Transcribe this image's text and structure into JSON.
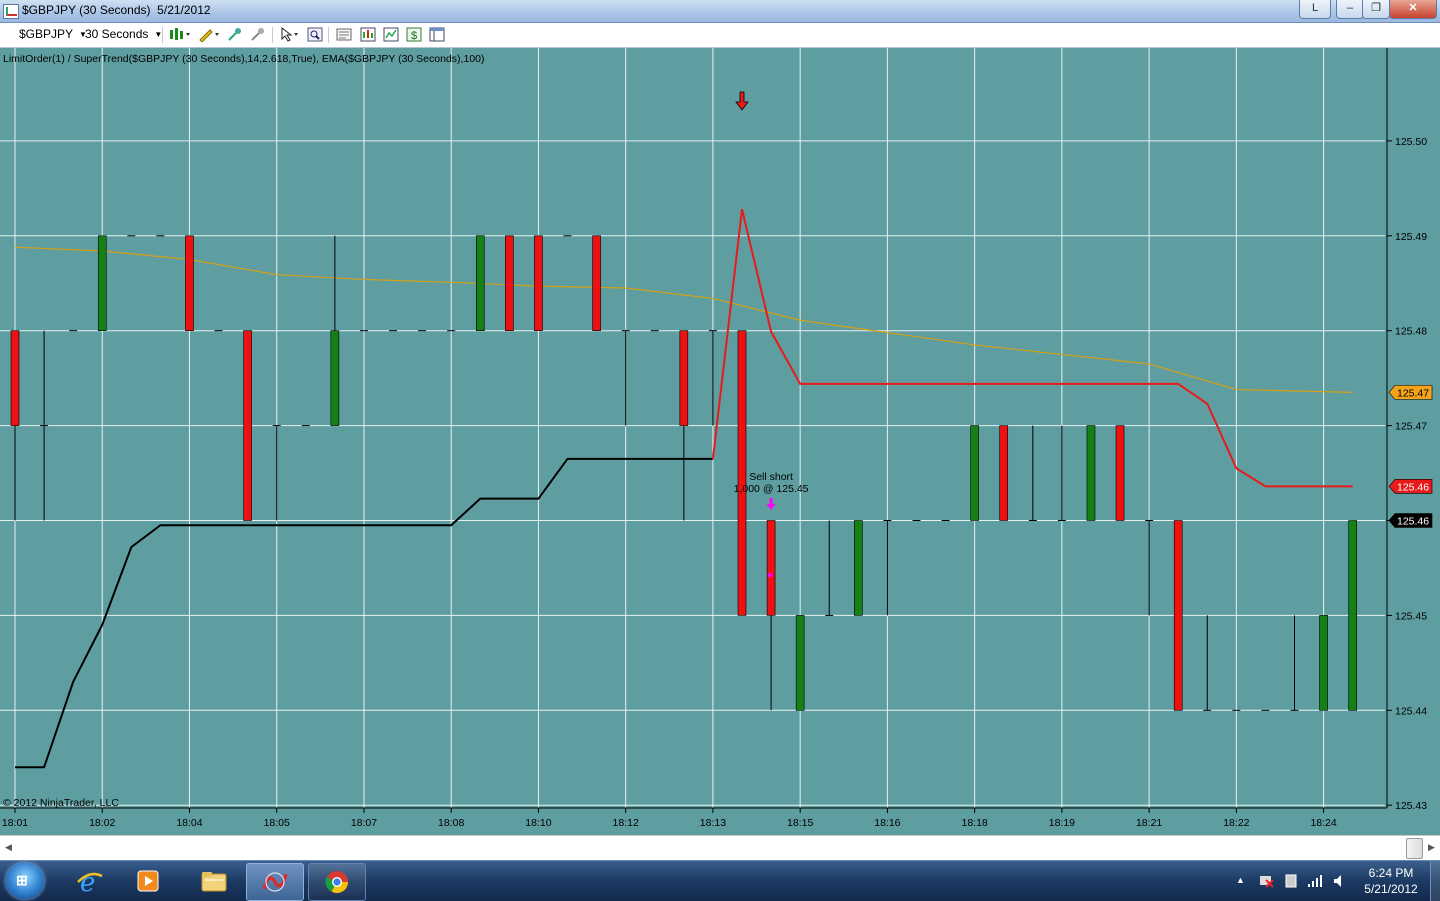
{
  "window": {
    "title": "$GBPJPY (30 Seconds)  5/21/2012",
    "btn_l": "L",
    "btn_min": "–",
    "btn_max": "❐",
    "btn_close": "✕"
  },
  "toolbar": {
    "instrument": "$GBPJPY",
    "period": "30 Seconds"
  },
  "chart_data": {
    "type": "candlestick",
    "title": "LimitOrder(1) / SuperTrend($GBPJPY (30 Seconds),14,2.618,True), EMA($GBPJPY (30 Seconds),100)",
    "copyright": "© 2012 NinjaTrader, LLC",
    "ylim": [
      125.43,
      125.51
    ],
    "y_ticks": [
      125.43,
      125.44,
      125.45,
      125.46,
      125.47,
      125.48,
      125.49,
      125.5
    ],
    "y_tick_labels": [
      "125.43",
      "125.44",
      "125.45",
      "125.46",
      "125.47",
      "125.48",
      "125.49",
      "125.50"
    ],
    "x_tick_labels": [
      "18:01",
      "18:02",
      "18:04",
      "18:05",
      "18:07",
      "18:08",
      "18:10",
      "18:12",
      "18:13",
      "18:15",
      "18:16",
      "18:18",
      "18:19",
      "18:21",
      "18:22",
      "18:24"
    ],
    "x_tick_bars": [
      0,
      3,
      6,
      9,
      12,
      15,
      18,
      21,
      24,
      27,
      30,
      33,
      36,
      39,
      42,
      45
    ],
    "grid": true,
    "bars": [
      {
        "o": 125.48,
        "h": 125.48,
        "l": 125.46,
        "c": 125.47
      },
      {
        "o": 125.47,
        "h": 125.48,
        "l": 125.46,
        "c": 125.47
      },
      {
        "o": 125.48,
        "h": 125.48,
        "l": 125.48,
        "c": 125.48
      },
      {
        "o": 125.48,
        "h": 125.49,
        "l": 125.48,
        "c": 125.49
      },
      {
        "o": 125.49,
        "h": 125.49,
        "l": 125.49,
        "c": 125.49
      },
      {
        "o": 125.49,
        "h": 125.49,
        "l": 125.49,
        "c": 125.49
      },
      {
        "o": 125.49,
        "h": 125.49,
        "l": 125.48,
        "c": 125.48
      },
      {
        "o": 125.48,
        "h": 125.48,
        "l": 125.48,
        "c": 125.48
      },
      {
        "o": 125.48,
        "h": 125.48,
        "l": 125.46,
        "c": 125.46
      },
      {
        "o": 125.47,
        "h": 125.47,
        "l": 125.46,
        "c": 125.47
      },
      {
        "o": 125.47,
        "h": 125.47,
        "l": 125.47,
        "c": 125.47
      },
      {
        "o": 125.47,
        "h": 125.49,
        "l": 125.47,
        "c": 125.48
      },
      {
        "o": 125.48,
        "h": 125.48,
        "l": 125.48,
        "c": 125.48
      },
      {
        "o": 125.48,
        "h": 125.48,
        "l": 125.48,
        "c": 125.48
      },
      {
        "o": 125.48,
        "h": 125.48,
        "l": 125.48,
        "c": 125.48
      },
      {
        "o": 125.48,
        "h": 125.48,
        "l": 125.48,
        "c": 125.48
      },
      {
        "o": 125.48,
        "h": 125.49,
        "l": 125.48,
        "c": 125.49
      },
      {
        "o": 125.49,
        "h": 125.49,
        "l": 125.48,
        "c": 125.48
      },
      {
        "o": 125.49,
        "h": 125.49,
        "l": 125.48,
        "c": 125.48
      },
      {
        "o": 125.49,
        "h": 125.49,
        "l": 125.49,
        "c": 125.49
      },
      {
        "o": 125.49,
        "h": 125.49,
        "l": 125.48,
        "c": 125.48
      },
      {
        "o": 125.48,
        "h": 125.48,
        "l": 125.47,
        "c": 125.48
      },
      {
        "o": 125.48,
        "h": 125.48,
        "l": 125.48,
        "c": 125.48
      },
      {
        "o": 125.48,
        "h": 125.48,
        "l": 125.46,
        "c": 125.47
      },
      {
        "o": 125.48,
        "h": 125.48,
        "l": 125.47,
        "c": 125.48
      },
      {
        "o": 125.48,
        "h": 125.48,
        "l": 125.45,
        "c": 125.45
      },
      {
        "o": 125.46,
        "h": 125.46,
        "l": 125.44,
        "c": 125.45
      },
      {
        "o": 125.44,
        "h": 125.45,
        "l": 125.44,
        "c": 125.45
      },
      {
        "o": 125.45,
        "h": 125.46,
        "l": 125.45,
        "c": 125.45
      },
      {
        "o": 125.45,
        "h": 125.46,
        "l": 125.45,
        "c": 125.46
      },
      {
        "o": 125.46,
        "h": 125.46,
        "l": 125.45,
        "c": 125.46
      },
      {
        "o": 125.46,
        "h": 125.46,
        "l": 125.46,
        "c": 125.46
      },
      {
        "o": 125.46,
        "h": 125.46,
        "l": 125.46,
        "c": 125.46
      },
      {
        "o": 125.46,
        "h": 125.47,
        "l": 125.46,
        "c": 125.47
      },
      {
        "o": 125.47,
        "h": 125.47,
        "l": 125.46,
        "c": 125.46
      },
      {
        "o": 125.46,
        "h": 125.47,
        "l": 125.46,
        "c": 125.46
      },
      {
        "o": 125.46,
        "h": 125.47,
        "l": 125.46,
        "c": 125.46
      },
      {
        "o": 125.46,
        "h": 125.47,
        "l": 125.46,
        "c": 125.47
      },
      {
        "o": 125.47,
        "h": 125.47,
        "l": 125.46,
        "c": 125.46
      },
      {
        "o": 125.46,
        "h": 125.46,
        "l": 125.45,
        "c": 125.46
      },
      {
        "o": 125.46,
        "h": 125.46,
        "l": 125.44,
        "c": 125.44
      },
      {
        "o": 125.44,
        "h": 125.45,
        "l": 125.44,
        "c": 125.44
      },
      {
        "o": 125.44,
        "h": 125.44,
        "l": 125.44,
        "c": 125.44
      },
      {
        "o": 125.44,
        "h": 125.44,
        "l": 125.44,
        "c": 125.44
      },
      {
        "o": 125.44,
        "h": 125.45,
        "l": 125.44,
        "c": 125.44
      },
      {
        "o": 125.44,
        "h": 125.45,
        "l": 125.44,
        "c": 125.45
      },
      {
        "o": 125.44,
        "h": 125.46,
        "l": 125.44,
        "c": 125.46
      }
    ],
    "supertrend_lower": {
      "color": "#000000",
      "points": [
        [
          0,
          125.434
        ],
        [
          1,
          125.434
        ],
        [
          2,
          125.443
        ],
        [
          3,
          125.449
        ],
        [
          4,
          125.4572
        ],
        [
          5,
          125.4595
        ],
        [
          6,
          125.4595
        ],
        [
          7,
          125.4595
        ],
        [
          8,
          125.4595
        ],
        [
          9,
          125.4595
        ],
        [
          10,
          125.4595
        ],
        [
          11,
          125.4595
        ],
        [
          12,
          125.4595
        ],
        [
          13,
          125.4595
        ],
        [
          14,
          125.4595
        ],
        [
          15,
          125.4595
        ],
        [
          16,
          125.4623
        ],
        [
          17,
          125.4623
        ],
        [
          18,
          125.4623
        ],
        [
          19,
          125.4665
        ],
        [
          20,
          125.4665
        ],
        [
          21,
          125.4665
        ],
        [
          22,
          125.4665
        ],
        [
          23,
          125.4665
        ],
        [
          24,
          125.4665
        ]
      ]
    },
    "supertrend_upper": {
      "color": "#e81a1a",
      "points": [
        [
          24,
          125.4665
        ],
        [
          25,
          125.4928
        ],
        [
          26,
          125.4799
        ],
        [
          27,
          125.4744
        ],
        [
          28,
          125.4744
        ],
        [
          29,
          125.4744
        ],
        [
          30,
          125.4744
        ],
        [
          31,
          125.4744
        ],
        [
          32,
          125.4744
        ],
        [
          33,
          125.4744
        ],
        [
          34,
          125.4744
        ],
        [
          35,
          125.4744
        ],
        [
          36,
          125.4744
        ],
        [
          37,
          125.4744
        ],
        [
          38,
          125.4744
        ],
        [
          39,
          125.4744
        ],
        [
          40,
          125.4744
        ],
        [
          41,
          125.4723
        ],
        [
          42,
          125.4655
        ],
        [
          43,
          125.4636
        ],
        [
          44,
          125.4636
        ],
        [
          45,
          125.4636
        ],
        [
          46,
          125.4636
        ]
      ]
    },
    "ema": {
      "color": "#d4a017",
      "points": [
        [
          0,
          125.4888
        ],
        [
          3,
          125.4884
        ],
        [
          6,
          125.4875
        ],
        [
          9,
          125.4859
        ],
        [
          12,
          125.4854
        ],
        [
          15,
          125.4851
        ],
        [
          18,
          125.4847
        ],
        [
          21,
          125.4845
        ],
        [
          24,
          125.4834
        ],
        [
          27,
          125.4811
        ],
        [
          30,
          125.4798
        ],
        [
          33,
          125.4785
        ],
        [
          36,
          125.4775
        ],
        [
          39,
          125.4765
        ],
        [
          42,
          125.4738
        ],
        [
          46,
          125.4735
        ]
      ]
    },
    "price_markers": [
      {
        "label": "125.47",
        "value": 125.4735,
        "bg": "#f5a31a",
        "fg": "#000000"
      },
      {
        "label": "125.46",
        "value": 125.4636,
        "bg": "#e81a1a",
        "fg": "#ffffff"
      },
      {
        "label": "125.46",
        "value": 125.46,
        "bg": "#000000",
        "fg": "#ffffff"
      }
    ],
    "annotations": {
      "signal_arrow_bar": 25,
      "signal_arrow_color": "#e81a1a",
      "trade_bar": 26,
      "trade_label_line1": "Sell short",
      "trade_label_line2": "1,000 @ 125.45",
      "trade_marker_color": "#ff00ff"
    },
    "colors": {
      "background": "#5f9ea0",
      "up": "#158015",
      "down": "#ee1111",
      "grid": "#ffffff",
      "wick": "#000000"
    }
  },
  "taskbar": {
    "time": "6:24 PM",
    "date": "5/21/2012",
    "apps": [
      "start-orb",
      "internet-explorer-icon",
      "media-player-icon",
      "file-explorer-icon",
      "ninjatrader-icon",
      "chrome-icon"
    ]
  }
}
